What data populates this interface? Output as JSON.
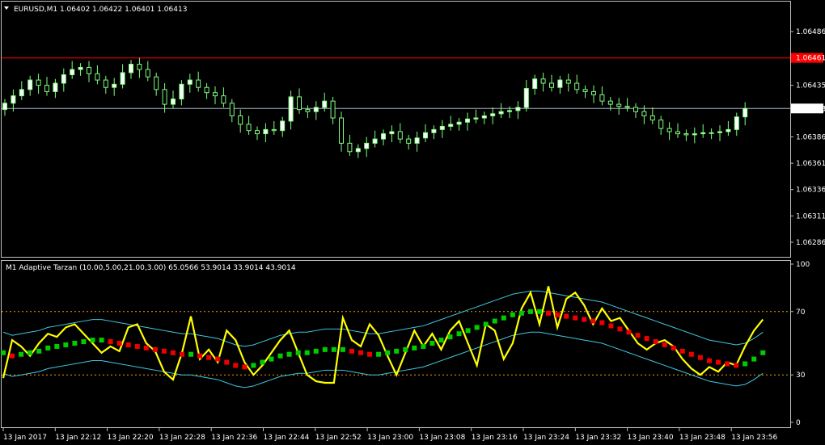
{
  "main_chart": {
    "header": "EURUSD,M1  1.06402 1.06422 1.06401 1.06413",
    "price_labels": [
      "1.06486",
      "1.06461",
      "1.06435",
      "1.06413",
      "1.06386",
      "1.06361",
      "1.06336",
      "1.06311",
      "1.06286"
    ],
    "red_line_price": "1.06461",
    "current_price": "1.06413",
    "colors": {
      "bull": "#ffffff",
      "bear": "#000000",
      "wick": "#7fff7f",
      "red_line": "#ff0000",
      "bid_line": "#a0b0c0"
    }
  },
  "indicator": {
    "header": "M1 Adaptive Tarzan (10.00,5.00,21.00,3.00) 65.0566 53.9014 33.9014 43.9014",
    "scale_labels": [
      "100",
      "70",
      "30",
      "0"
    ],
    "levels": [
      70,
      30
    ],
    "colors": {
      "rsi": "#ffff00",
      "band": "#40c8e0",
      "up": "#00cc00",
      "down": "#ee0000",
      "level": "#ff9900"
    }
  },
  "time_axis": [
    "13 Jan 2017",
    "13 Jan 22:12",
    "13 Jan 22:20",
    "13 Jan 22:28",
    "13 Jan 22:36",
    "13 Jan 22:44",
    "13 Jan 22:52",
    "13 Jan 23:00",
    "13 Jan 23:08",
    "13 Jan 23:16",
    "13 Jan 23:24",
    "13 Jan 23:32",
    "13 Jan 23:40",
    "13 Jan 23:48",
    "13 Jan 23:56"
  ],
  "chart_data": [
    {
      "type": "candlestick",
      "title": "EURUSD,M1",
      "ylim": [
        1.06276,
        1.06506
      ],
      "close_series": [
        1.06418,
        1.06425,
        1.06431,
        1.0644,
        1.06435,
        1.06429,
        1.06437,
        1.06445,
        1.0645,
        1.06452,
        1.06446,
        1.0644,
        1.06433,
        1.06436,
        1.06447,
        1.06455,
        1.0645,
        1.06443,
        1.06431,
        1.06417,
        1.06422,
        1.06436,
        1.0644,
        1.06433,
        1.06428,
        1.06425,
        1.06418,
        1.06406,
        1.06398,
        1.06392,
        1.06389,
        1.06393,
        1.06392,
        1.06401,
        1.06424,
        1.06412,
        1.0641,
        1.06414,
        1.0642,
        1.06404,
        1.0638,
        1.06372,
        1.06375,
        1.0638,
        1.06384,
        1.06389,
        1.06391,
        1.06384,
        1.0638,
        1.06385,
        1.0639,
        1.06393,
        1.06396,
        1.06398,
        1.064,
        1.06403,
        1.06404,
        1.06406,
        1.06408,
        1.0641,
        1.06411,
        1.06414,
        1.06432,
        1.06441,
        1.06437,
        1.06433,
        1.0644,
        1.06437,
        1.06431,
        1.06429,
        1.06426,
        1.0642,
        1.06417,
        1.06415,
        1.06414,
        1.0641,
        1.06406,
        1.06402,
        1.06394,
        1.06391,
        1.06389,
        1.06388,
        1.06389,
        1.0639,
        1.0639,
        1.06391,
        1.06393,
        1.06405,
        1.06413
      ],
      "red_line": 1.06461,
      "bid": 1.06413
    },
    {
      "type": "line",
      "title": "M1 Adaptive Tarzan (10.00,5.00,21.00,3.00)",
      "ylim": [
        0,
        100
      ],
      "levels": [
        70,
        30
      ],
      "series": [
        {
          "name": "rsi",
          "values": [
            28,
            52,
            48,
            42,
            50,
            56,
            54,
            60,
            62,
            56,
            50,
            44,
            48,
            45,
            60,
            62,
            50,
            45,
            32,
            27,
            44,
            67,
            40,
            46,
            38,
            58,
            52,
            38,
            30,
            36,
            44,
            52,
            58,
            44,
            30,
            26,
            25,
            25,
            66,
            52,
            48,
            62,
            55,
            42,
            30,
            44,
            58,
            48,
            56,
            46,
            58,
            64,
            50,
            36,
            62,
            58,
            40,
            50,
            72,
            82,
            62,
            86,
            60,
            78,
            82,
            74,
            62,
            72,
            64,
            66,
            58,
            50,
            46,
            50,
            52,
            48,
            40,
            34,
            30,
            35,
            32,
            38,
            36,
            48,
            58,
            65
          ]
        },
        {
          "name": "signal",
          "values": [
            44,
            42,
            43,
            44,
            45,
            47,
            48,
            49,
            50,
            51,
            52,
            52,
            51,
            50,
            49,
            48,
            47,
            46,
            45,
            44,
            43,
            43,
            42,
            41,
            40,
            38,
            36,
            35,
            36,
            38,
            40,
            42,
            43,
            44,
            44,
            45,
            46,
            46,
            46,
            45,
            44,
            43,
            43,
            44,
            45,
            46,
            47,
            48,
            50,
            52,
            54,
            56,
            58,
            60,
            62,
            64,
            66,
            68,
            69,
            70,
            70,
            69,
            68,
            67,
            66,
            65,
            64,
            63,
            61,
            59,
            57,
            55,
            53,
            51,
            49,
            47,
            45,
            43,
            41,
            39,
            38,
            37,
            36,
            37,
            40,
            44
          ]
        }
      ]
    }
  ]
}
